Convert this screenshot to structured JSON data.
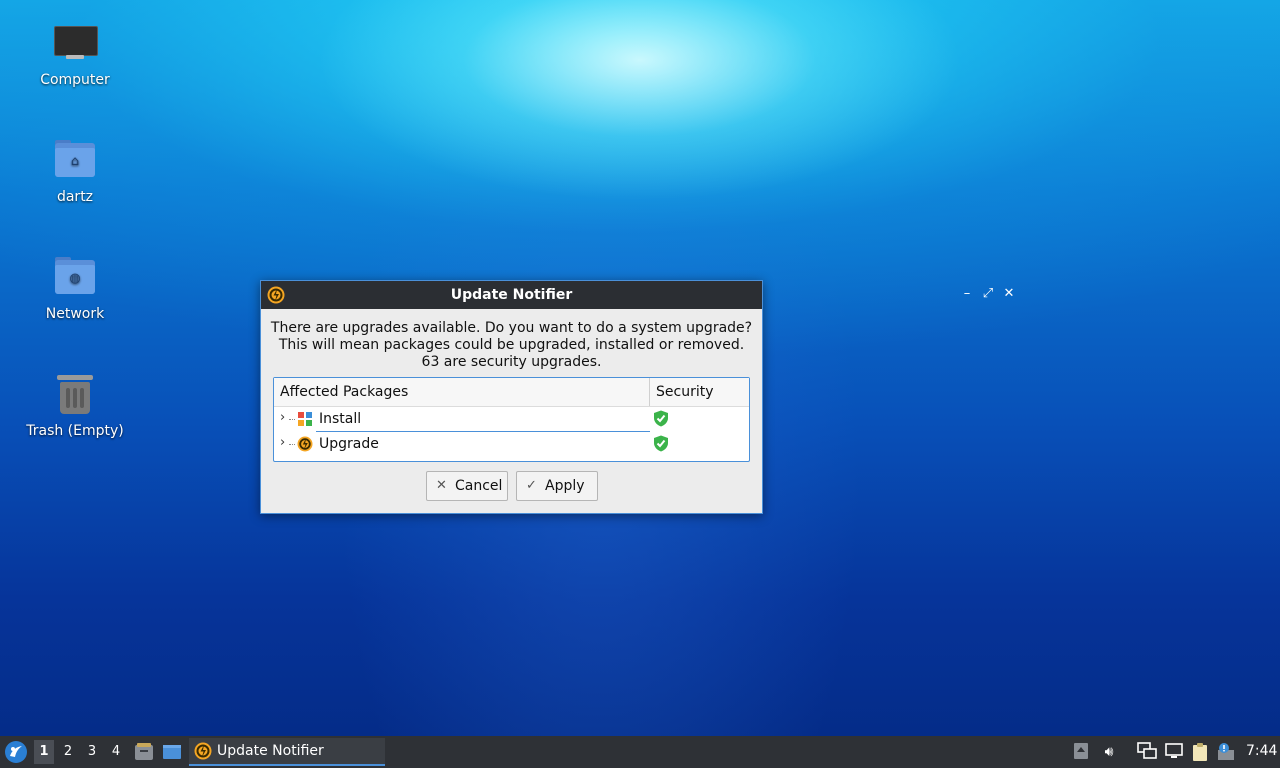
{
  "desktop": {
    "icons": [
      {
        "label": "Computer",
        "icon": "computer-icon"
      },
      {
        "label": "dartz",
        "icon": "home-folder-icon"
      },
      {
        "label": "Network",
        "icon": "network-folder-icon"
      },
      {
        "label": "Trash (Empty)",
        "icon": "trash-icon"
      }
    ]
  },
  "dialog": {
    "title": "Update Notifier",
    "message_line1": "There are upgrades available. Do you want to do a system upgrade?",
    "message_line2": "This will mean packages could be upgraded, installed or removed.",
    "message_line3": "63 are security upgrades.",
    "table": {
      "headers": [
        "Affected Packages",
        "Security"
      ],
      "rows": [
        {
          "label": "Install",
          "icon": "install-icon",
          "security": "shield-check-icon",
          "selected": true
        },
        {
          "label": "Upgrade",
          "icon": "upgrade-icon",
          "security": "shield-check-icon",
          "selected": false
        }
      ]
    },
    "buttons": {
      "cancel": "Cancel",
      "apply": "Apply"
    }
  },
  "taskbar": {
    "workspaces": [
      "1",
      "2",
      "3",
      "4"
    ],
    "active_workspace": "1",
    "task_label": "Update Notifier",
    "clock": "7:44"
  },
  "colors": {
    "accent": "#4a90d9",
    "titlebar": "#2b2e33",
    "taskbar": "#2e3136",
    "update_orange": "#f5a623",
    "shield_green": "#3bb34a"
  }
}
